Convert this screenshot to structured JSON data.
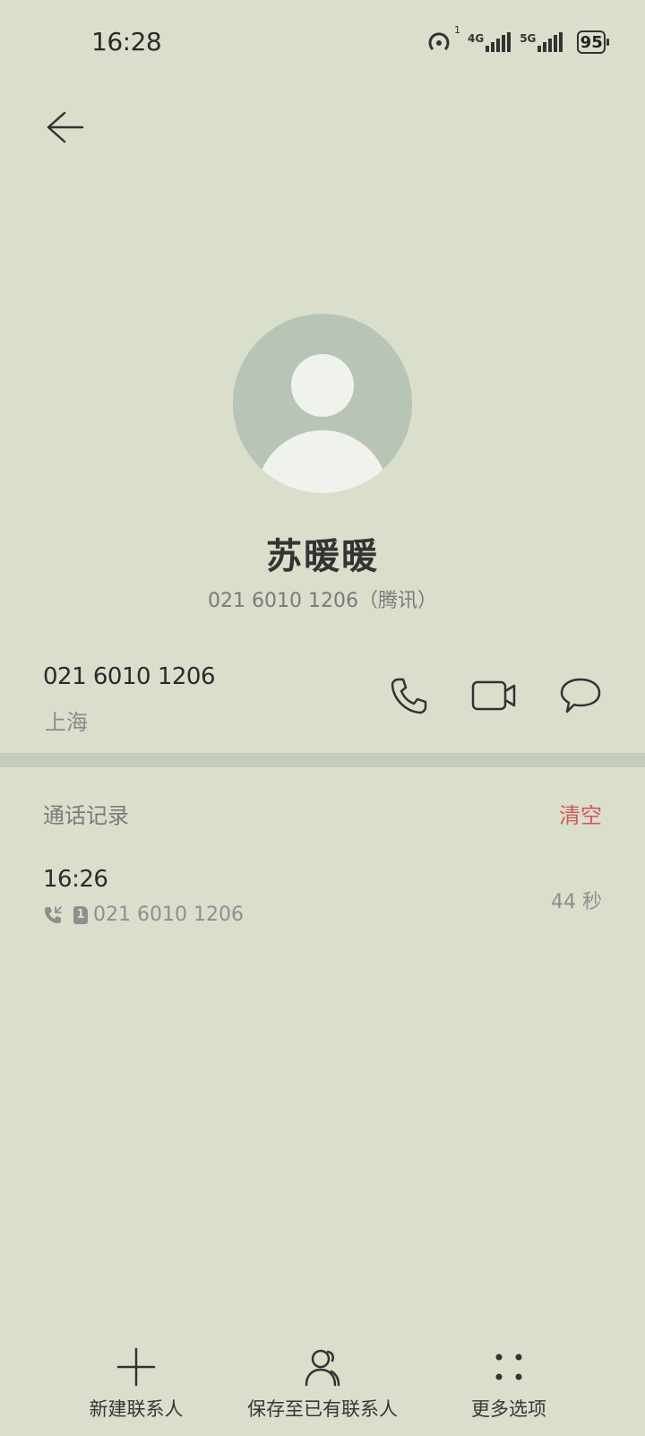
{
  "status_bar": {
    "time": "16:28",
    "sim1_network": "4G",
    "sim2_network": "5G",
    "battery": "95",
    "hotspot_badge": "1"
  },
  "contact": {
    "name": "苏暖暖",
    "subtitle": "021 6010 1206（腾讯）",
    "number": "021 6010 1206",
    "location": "上海"
  },
  "call_log": {
    "title": "通话记录",
    "clear_label": "清空",
    "records": [
      {
        "time": "16:26",
        "sim": "1",
        "number": "021 6010 1206",
        "duration": "44 秒"
      }
    ]
  },
  "bottom_bar": {
    "new_contact": "新建联系人",
    "save_to_existing": "保存至已有联系人",
    "more_options": "更多选项"
  },
  "colors": {
    "background": "#dadfcc",
    "accent_red": "#d0595b",
    "avatar_bg": "#b8c4b6"
  }
}
